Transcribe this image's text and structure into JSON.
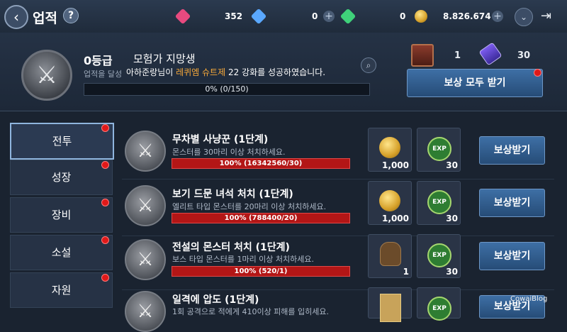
{
  "header": {
    "title": "업적",
    "currencies": [
      {
        "name": "ruby",
        "value": "352",
        "color": "#e84a7f"
      },
      {
        "name": "diamond",
        "value": "0",
        "color": "#5aa8ff"
      },
      {
        "name": "emerald",
        "value": "0",
        "color": "#3fd17a"
      },
      {
        "name": "gold",
        "value": "8.826.674",
        "color": "#e0b23a"
      }
    ]
  },
  "summary": {
    "grade": "0등급",
    "rank_title": "모험가 지망생",
    "description": "업적을 달성",
    "notice_prefix": "아하준랑님이 ",
    "notice_item": "레퀴엠 슈트제",
    "notice_suffix": " 22 강화를 성공하였습니다.",
    "progress_text": "0% (0/150)",
    "progress_value": 0,
    "reward_chest_count": "1",
    "reward_scroll_count": "30",
    "claim_all_label": "보상 모두 받기"
  },
  "sidebar": {
    "items": [
      {
        "label": "전투",
        "active": true
      },
      {
        "label": "성장",
        "active": false
      },
      {
        "label": "장비",
        "active": false
      },
      {
        "label": "소설",
        "active": false
      },
      {
        "label": "자원",
        "active": false
      }
    ]
  },
  "quests": [
    {
      "title": "무차별 사냥꾼 (1단계)",
      "desc": "몬스터를 30마리 이상 처치하세요.",
      "progress": "100% (16342560/30)",
      "progress_value": 1.0,
      "reward1": "1,000",
      "reward2": "30",
      "button": "보상받기"
    },
    {
      "title": "보기 드문 녀석 처치 (1단계)",
      "desc": "엘리트 타입 몬스터를 20마리 이상 처치하세요.",
      "progress": "100% (788400/20)",
      "progress_value": 1.0,
      "reward1": "1,000",
      "reward2": "30",
      "button": "보상받기"
    },
    {
      "title": "전설의 몬스터 처치 (1단계)",
      "desc": "보스 타입 몬스터를 1마리 이상 처치하세요.",
      "progress": "100% (520/1)",
      "progress_value": 1.0,
      "reward1": "1",
      "reward2": "30",
      "button": "보상받기"
    },
    {
      "title": "일격에 압도 (1단계)",
      "desc": "1회 공격으로 적에게 410이상 피해를 입히세요.",
      "reward2": "30",
      "button": "보상받기"
    }
  ],
  "watermark": "CowaiBlog"
}
